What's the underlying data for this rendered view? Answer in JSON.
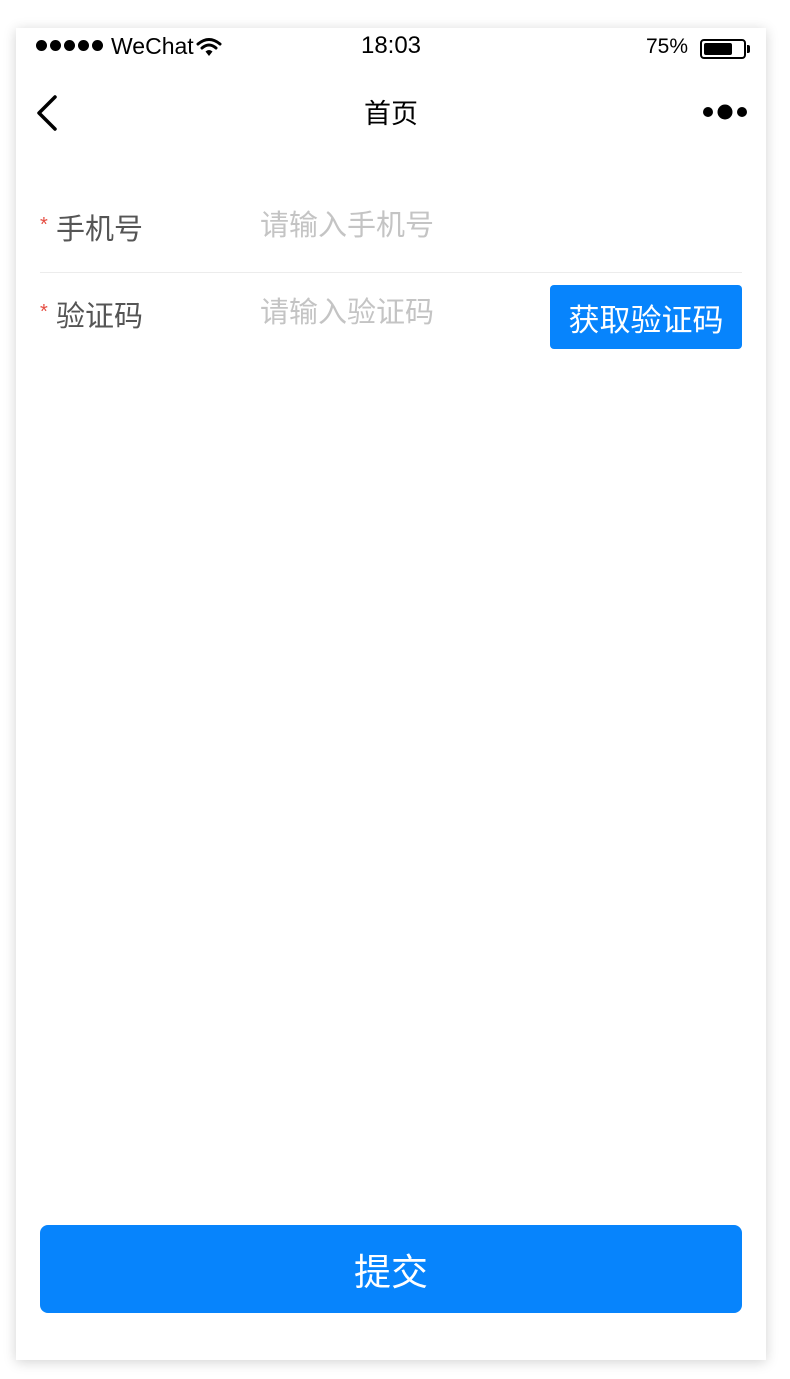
{
  "status_bar": {
    "carrier": "WeChat",
    "time": "18:03",
    "battery_percent": "75%",
    "battery_level": 0.75,
    "icons": [
      "signal-dots-icon",
      "wifi-icon",
      "battery-icon"
    ]
  },
  "nav": {
    "title": "首页",
    "back_icon": "chevron-left-icon",
    "more_icon": "more-dots-icon"
  },
  "form": {
    "phone": {
      "required": "*",
      "label": "手机号",
      "value": "",
      "placeholder": "请输入手机号"
    },
    "code": {
      "required": "*",
      "label": "验证码",
      "value": "",
      "placeholder": "请输入验证码",
      "button_label": "获取验证码"
    }
  },
  "submit_label": "提交",
  "colors": {
    "primary": "#0784fc",
    "required": "#e54d42",
    "placeholder": "#c4c4c4",
    "label": "#555555"
  }
}
